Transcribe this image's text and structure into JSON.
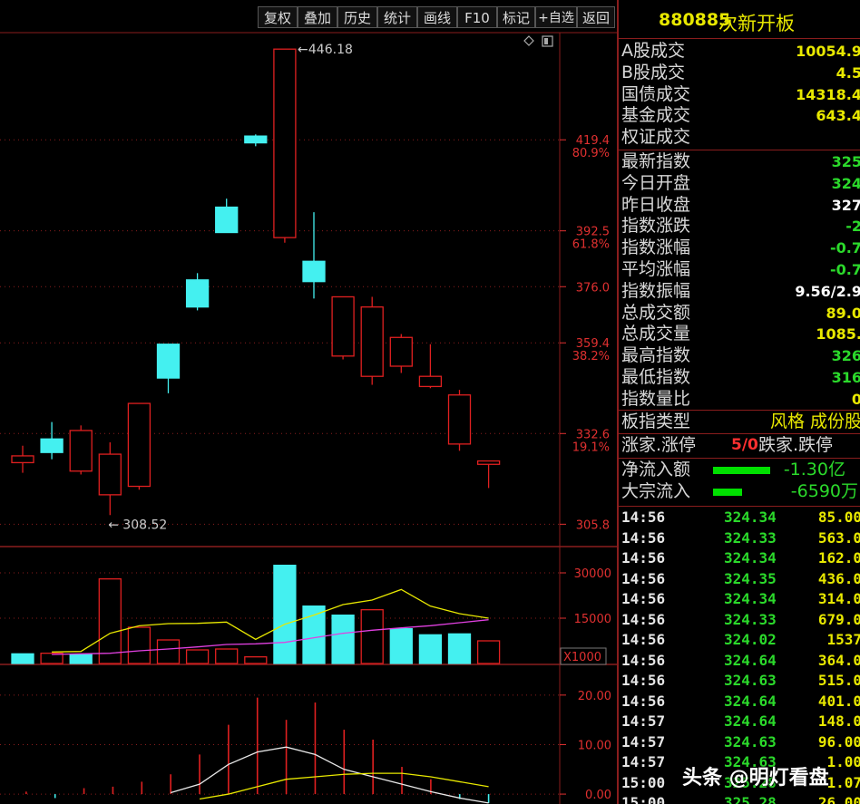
{
  "toolbar": {
    "buttons": [
      "复权",
      "叠加",
      "历史",
      "统计",
      "画线",
      "F10",
      "标记",
      "+自选",
      "返回"
    ]
  },
  "price_panel": {
    "tick_labels": [
      "419.4",
      "392.5",
      "376.0",
      "359.4",
      "332.6",
      "305.8"
    ],
    "pct_labels": [
      "80.9%",
      "61.8%",
      "38.2%",
      "19.1%"
    ],
    "high_annotation": "446.18",
    "low_annotation": "308.52",
    "icons": [
      "diamond-icon",
      "layout-icon"
    ]
  },
  "volume_panel": {
    "tick_labels": [
      "30000",
      "15000"
    ],
    "unit_label": "X1000"
  },
  "macd_panel": {
    "tick_labels": [
      "20.00",
      "10.00",
      "0.00"
    ]
  },
  "chart_data": [
    {
      "type": "candlestick",
      "title": "",
      "ylim": [
        300,
        450
      ],
      "ticks": [
        419.4,
        392.5,
        376.0,
        359.4,
        332.6,
        305.8
      ],
      "candles": [
        {
          "open": 324.0,
          "close": 326.0,
          "high": 329.0,
          "low": 321.0
        },
        {
          "open": 331.0,
          "close": 327.0,
          "high": 336.0,
          "low": 325.0
        },
        {
          "open": 321.5,
          "close": 333.5,
          "high": 335.0,
          "low": 320.5
        },
        {
          "open": 314.5,
          "close": 326.5,
          "high": 330.0,
          "low": 308.5
        },
        {
          "open": 317.0,
          "close": 341.5,
          "high": 341.5,
          "low": 316.0
        },
        {
          "open": 359.0,
          "close": 349.0,
          "high": 359.0,
          "low": 344.5
        },
        {
          "open": 378.0,
          "close": 370.0,
          "high": 380.0,
          "low": 369.0
        },
        {
          "open": 399.5,
          "close": 392.0,
          "high": 402.0,
          "low": 392.0
        },
        {
          "open": 420.5,
          "close": 418.5,
          "high": 421.0,
          "low": 417.5
        },
        {
          "open": 390.5,
          "close": 446.2,
          "high": 446.2,
          "low": 389.0
        },
        {
          "open": 383.5,
          "close": 377.5,
          "high": 398.0,
          "low": 372.5
        },
        {
          "open": 355.5,
          "close": 373.0,
          "high": 373.0,
          "low": 354.5
        },
        {
          "open": 349.5,
          "close": 370.0,
          "high": 373.0,
          "low": 347.0
        },
        {
          "open": 352.5,
          "close": 361.0,
          "high": 362.0,
          "low": 350.5
        },
        {
          "open": 346.5,
          "close": 349.5,
          "high": 359.0,
          "low": 346.0
        },
        {
          "open": 329.5,
          "close": 344.0,
          "high": 345.5,
          "low": 327.5
        },
        {
          "open": 323.5,
          "close": 324.5,
          "high": 324.5,
          "low": 316.5
        }
      ]
    },
    {
      "type": "bar",
      "title": "",
      "ylim": [
        0,
        36000
      ],
      "ticks": [
        30000,
        15000
      ],
      "values": [
        3200,
        3400,
        3000,
        28000,
        12000,
        7800,
        4500,
        4800,
        2200,
        32500,
        19000,
        16000,
        17800,
        11500,
        9500,
        9800,
        7500
      ],
      "rising": [
        false,
        true,
        false,
        true,
        true,
        true,
        true,
        true,
        true,
        false,
        false,
        false,
        true,
        false,
        false,
        false,
        true
      ],
      "series": [
        {
          "color": "#e8e800",
          "values": [
            null,
            3800,
            4000,
            10000,
            12500,
            13200,
            13300,
            13700,
            8000,
            13000,
            16000,
            19500,
            21000,
            24500,
            19000,
            16500,
            15000
          ]
        },
        {
          "color": "#e040e0",
          "values": [
            null,
            3000,
            3200,
            3400,
            4200,
            4800,
            5500,
            6300,
            6500,
            7000,
            8500,
            10000,
            11000,
            11800,
            12500,
            13500,
            14500
          ]
        }
      ]
    },
    {
      "type": "bar",
      "title": "",
      "ylim": [
        -2,
        24
      ],
      "ticks": [
        20.0,
        10.0,
        0.0
      ],
      "values": [
        -0.8,
        0.5,
        -0.8,
        1.2,
        1.5,
        2.5,
        4.0,
        8.0,
        14.0,
        19.5,
        15.0,
        18.5,
        13.0,
        11.0,
        5.5,
        3.0,
        -1.0,
        -1.8
      ],
      "series": [
        {
          "color": "#e8e8e8",
          "values": [
            null,
            null,
            null,
            null,
            null,
            null,
            0.3,
            2.0,
            6.0,
            8.5,
            9.5,
            8.0,
            5.0,
            3.5,
            2.0,
            0.5,
            -0.8,
            -1.8
          ]
        },
        {
          "color": "#e8e800",
          "values": [
            null,
            null,
            null,
            null,
            null,
            null,
            null,
            -1.0,
            0.0,
            1.5,
            3.0,
            3.5,
            4.0,
            4.2,
            4.2,
            3.5,
            2.5,
            1.5
          ]
        }
      ]
    }
  ],
  "panel": {
    "title_code": "880885",
    "title_name": "次新开板",
    "stats": [
      {
        "label": "A股成交",
        "value": "10054.9",
        "color": "#e8e800"
      },
      {
        "label": "B股成交",
        "value": "4.5",
        "color": "#e8e800"
      },
      {
        "label": "国债成交",
        "value": "14318.4",
        "color": "#e8e800"
      },
      {
        "label": "基金成交",
        "value": "643.4",
        "color": "#e8e800"
      },
      {
        "label": "权证成交",
        "value": "",
        "color": "#e8e800"
      }
    ],
    "index": [
      {
        "label": "最新指数",
        "value": "325",
        "color": "#2bd92b"
      },
      {
        "label": "今日开盘",
        "value": "324",
        "color": "#2bd92b"
      },
      {
        "label": "昨日收盘",
        "value": "327",
        "color": "#ffffff"
      },
      {
        "label": "指数涨跌",
        "value": "-2",
        "color": "#2bd92b"
      },
      {
        "label": "指数涨幅",
        "value": "-0.7",
        "color": "#2bd92b"
      },
      {
        "label": "平均涨幅",
        "value": "-0.7",
        "color": "#2bd92b"
      },
      {
        "label": "指数振幅",
        "value": "9.56/2.9",
        "color": "#ffffff"
      },
      {
        "label": "总成交额",
        "value": "89.0",
        "color": "#e8e800"
      },
      {
        "label": "总成交量",
        "value": "1085.",
        "color": "#e8e800"
      },
      {
        "label": "最高指数",
        "value": "326",
        "color": "#2bd92b"
      },
      {
        "label": "最低指数",
        "value": "316",
        "color": "#2bd92b"
      },
      {
        "label": "指数量比",
        "value": "0",
        "color": "#e8e800"
      }
    ],
    "type_label": "板指类型",
    "type_value": "风格 成份股",
    "rise_label": "涨家.涨停",
    "rise_value": "5/0",
    "fall_label": "跌家.跌停",
    "net_inflow_label": "净流入额",
    "net_inflow_value": "-1.30亿",
    "net_inflow_bar": 0.75,
    "block_inflow_label": "大宗流入",
    "block_inflow_value": "-6590万",
    "block_inflow_bar": 0.38,
    "ticks": [
      {
        "time": "14:56",
        "price": "324.34",
        "vol": "85.00"
      },
      {
        "time": "14:56",
        "price": "324.33",
        "vol": "563.0"
      },
      {
        "time": "14:56",
        "price": "324.34",
        "vol": "162.0"
      },
      {
        "time": "14:56",
        "price": "324.35",
        "vol": "436.0"
      },
      {
        "time": "14:56",
        "price": "324.34",
        "vol": "314.0"
      },
      {
        "time": "14:56",
        "price": "324.33",
        "vol": "679.0"
      },
      {
        "time": "14:56",
        "price": "324.02",
        "vol": "1537"
      },
      {
        "time": "14:56",
        "price": "324.64",
        "vol": "364.0"
      },
      {
        "time": "14:56",
        "price": "324.63",
        "vol": "515.0"
      },
      {
        "time": "14:56",
        "price": "324.64",
        "vol": "401.0"
      },
      {
        "time": "14:57",
        "price": "324.64",
        "vol": "148.0"
      },
      {
        "time": "14:57",
        "price": "324.63",
        "vol": "96.00"
      },
      {
        "time": "14:57",
        "price": "324.63",
        "vol": "1.00"
      },
      {
        "time": "15:00",
        "price": "325.28",
        "vol": "1.07"
      },
      {
        "time": "15:00",
        "price": "325.28",
        "vol": "26.00"
      }
    ]
  },
  "watermark": "头条 @明灯看盘",
  "colors": {
    "up": "#e02020",
    "down": "#44f0f0",
    "grid": "#8a1d1d",
    "axis_text": "#e03030"
  }
}
